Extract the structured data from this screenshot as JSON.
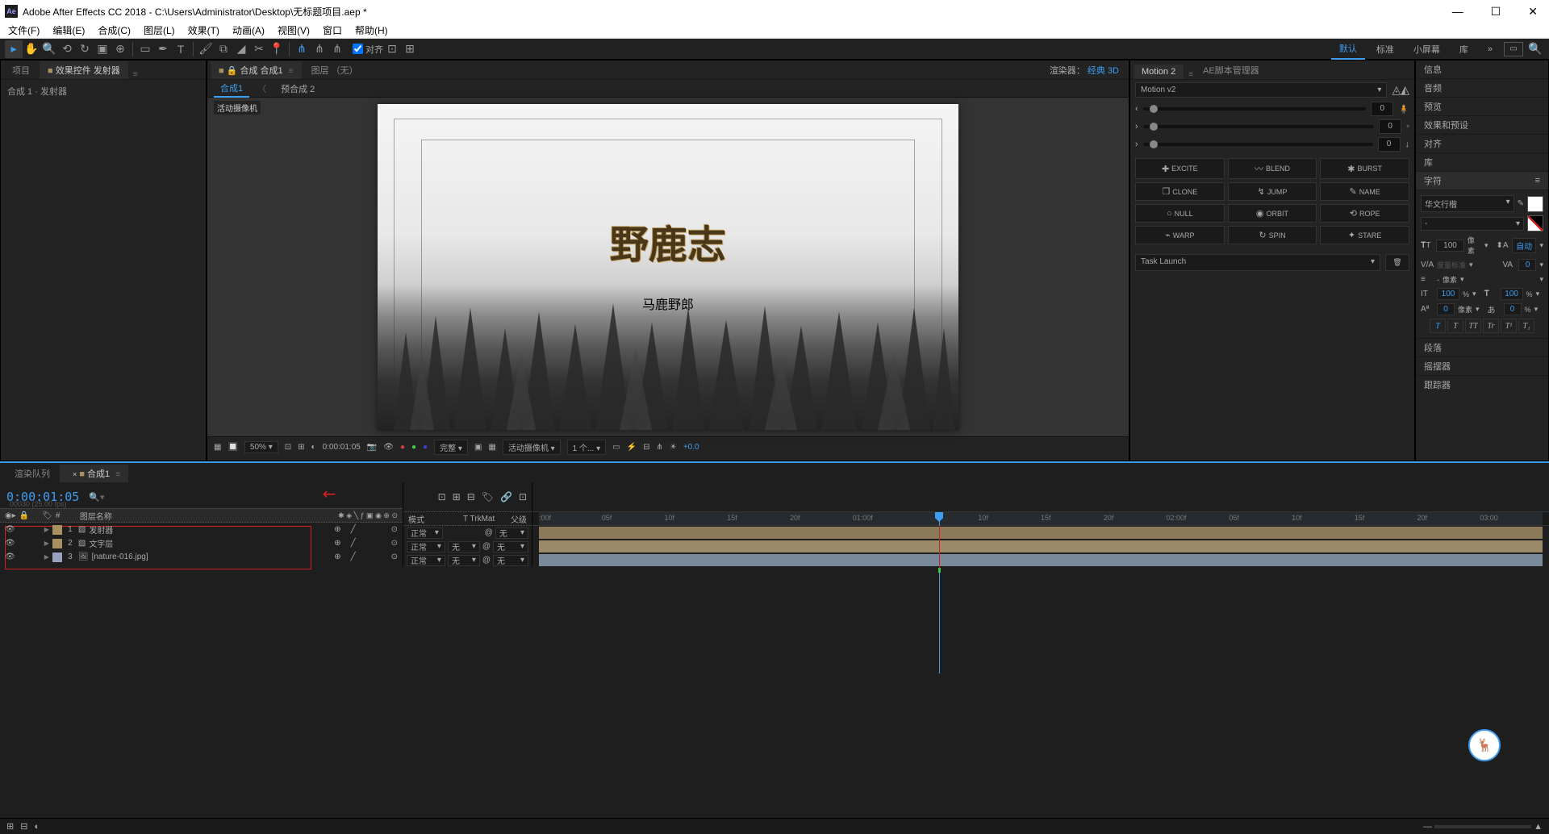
{
  "titlebar": {
    "app": "Adobe After Effects CC 2018",
    "path": "C:\\Users\\Administrator\\Desktop\\无标题项目.aep *",
    "min": "—",
    "max": "☐",
    "close": "✕"
  },
  "menubar": [
    "文件(F)",
    "编辑(E)",
    "合成(C)",
    "图层(L)",
    "效果(T)",
    "动画(A)",
    "视图(V)",
    "窗口",
    "帮助(H)"
  ],
  "toolbar": {
    "snap_label": "对齐"
  },
  "workspaces": {
    "active": "默认",
    "items": [
      "默认",
      "标准",
      "小屏幕",
      "库"
    ],
    "more": "»"
  },
  "project": {
    "tabs": [
      "项目",
      "效果控件 发射器"
    ],
    "sub": "合成 1 · 发射器"
  },
  "comp": {
    "tabs_main": "合成 合成1",
    "layer_tab": "图层 （无）",
    "renderer": "渲染器：",
    "renderer_val": "经典 3D",
    "comp_tabs": [
      "合成1",
      "预合成 2"
    ],
    "camera_label": "活动摄像机",
    "title_text": "野鹿志",
    "subtitle_text": "马鹿野郎",
    "footer": {
      "zoom": "50%",
      "timecode": "0:00:01:05",
      "res": "完整",
      "camera": "活动摄像机",
      "views": "1 个...",
      "exposure": "+0.0"
    }
  },
  "motion2": {
    "tab1": "Motion 2",
    "tab2": "AE脚本管理器",
    "version": "Motion v2",
    "sliders": [
      0,
      0,
      0
    ],
    "buttons": [
      {
        "ic": "✚",
        "t": "EXCITE"
      },
      {
        "ic": "〰",
        "t": "BLEND"
      },
      {
        "ic": "✱",
        "t": "BURST"
      },
      {
        "ic": "❐",
        "t": "CLONE"
      },
      {
        "ic": "↯",
        "t": "JUMP"
      },
      {
        "ic": "✎",
        "t": "NAME"
      },
      {
        "ic": "○",
        "t": "NULL"
      },
      {
        "ic": "◉",
        "t": "ORBIT"
      },
      {
        "ic": "⟲",
        "t": "ROPE"
      },
      {
        "ic": "⌁",
        "t": "WARP"
      },
      {
        "ic": "↻",
        "t": "SPIN"
      },
      {
        "ic": "✦",
        "t": "STARE"
      }
    ],
    "task": "Task Launch"
  },
  "sidebar": {
    "panels": [
      "信息",
      "音频",
      "预览",
      "效果和预设",
      "对齐",
      "库"
    ],
    "char_title": "字符",
    "font": "华文行楷",
    "style": "-",
    "size": "100",
    "size_unit": "像素",
    "leading": "自动",
    "kerning": "度量标准",
    "tracking": "0",
    "vscale": "100",
    "hscale": "100",
    "baseline": "0",
    "tsume": "0",
    "px_unit": "像素",
    "pct_unit": "%",
    "faux": [
      "T",
      "T",
      "TT",
      "Tr",
      "T¹",
      "T₁"
    ],
    "collapsed": [
      "段落",
      "摇摆器",
      "跟踪器"
    ]
  },
  "timeline": {
    "tabs": [
      "渲染队列",
      "合成1"
    ],
    "timecode": "0:00:01:05",
    "sub": "00030 (25.00 fps)",
    "layer_hdr": "图层名称",
    "mode_hdr": "模式",
    "trkmat_hdr": "T  TrkMat",
    "parent_hdr": "父级",
    "layers": [
      {
        "idx": "1",
        "color": "#a89060",
        "name": "发射器",
        "mode": "正常",
        "trk": "",
        "parent": "无"
      },
      {
        "idx": "2",
        "color": "#a89060",
        "name": "文字层",
        "mode": "正常",
        "trk": "无",
        "parent": "无"
      },
      {
        "idx": "3",
        "color": "#9aa0c0",
        "name": "[nature-016.jpg]",
        "mode": "正常",
        "trk": "无",
        "parent": "无"
      }
    ],
    "ruler": [
      ":00f",
      "05f",
      "10f",
      "15f",
      "20f",
      "01:00f",
      "",
      "10f",
      "15f",
      "20f",
      "02:00f",
      "05f",
      "10f",
      "15f",
      "20f",
      "03:00"
    ]
  }
}
